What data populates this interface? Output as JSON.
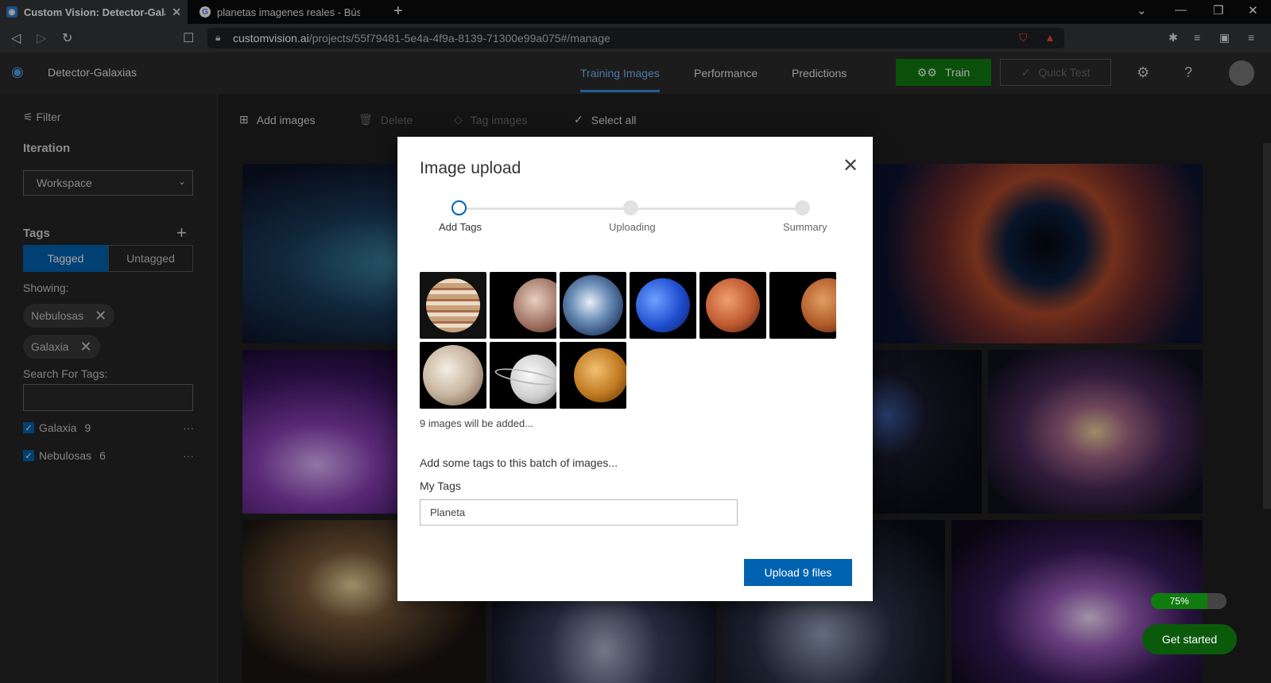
{
  "browser": {
    "tabs": [
      {
        "label": "Custom Vision: Detector-Galaxias",
        "active": true
      },
      {
        "label": "planetas imagenes reales - Búsqueda",
        "active": false
      }
    ],
    "url_host": "customvision.ai",
    "url_path": "/projects/55f79481-5e4a-4f9a-8139-71300e99a075#/manage"
  },
  "app": {
    "project_name": "Detector-Galaxias",
    "nav": [
      "Training Images",
      "Performance",
      "Predictions"
    ],
    "train_label": "Train",
    "quick_test_label": "Quick Test",
    "accent": "#0063b1",
    "train_color": "#107c10"
  },
  "sidebar": {
    "filter_label": "Filter",
    "iteration_heading": "Iteration",
    "iteration_value": "Workspace",
    "tags_heading": "Tags",
    "tagged_label": "Tagged",
    "untagged_label": "Untagged",
    "showing_label": "Showing:",
    "chips": [
      "Nebulosas",
      "Galaxia"
    ],
    "search_label": "Search For Tags:",
    "tags": [
      {
        "name": "Galaxia",
        "count": "9"
      },
      {
        "name": "Nebulosas",
        "count": "6"
      }
    ]
  },
  "toolbar": {
    "add_images": "Add images",
    "delete": "Delete",
    "tag_images": "Tag images",
    "select_all": "Select all"
  },
  "status": {
    "progress_label": "75%",
    "progress": 0.75,
    "get_started": "Get started"
  },
  "modal": {
    "title": "Image upload",
    "steps": [
      "Add Tags",
      "Uploading",
      "Summary"
    ],
    "current_step": 0,
    "count_text": "9 images will be added...",
    "prompt": "Add some tags to this batch of images...",
    "field_label": "My Tags",
    "field_value": "Planeta",
    "upload_button": "Upload 9 files"
  }
}
